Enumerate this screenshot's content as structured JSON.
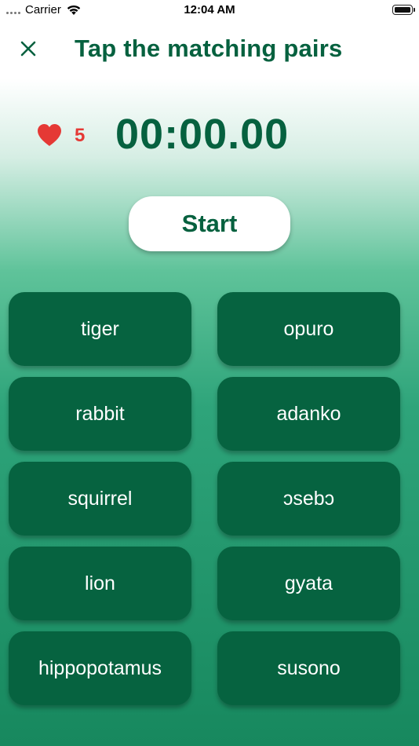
{
  "status_bar": {
    "carrier": "Carrier",
    "time": "12:04 AM"
  },
  "header": {
    "title": "Tap the matching pairs",
    "close_icon": "close-icon"
  },
  "stats": {
    "lives": "5",
    "heart_color": "#e53935",
    "timer": "00:00.00"
  },
  "start_button": {
    "label": "Start"
  },
  "pairs": {
    "left": [
      "tiger",
      "rabbit",
      "squirrel",
      "lion",
      "hippopotamus"
    ],
    "right": [
      "opuro",
      "adanko",
      "ɔsebɔ",
      "gyata",
      "susono"
    ]
  },
  "colors": {
    "primary": "#06613f",
    "card": "#066340",
    "accent_red": "#e53935"
  }
}
